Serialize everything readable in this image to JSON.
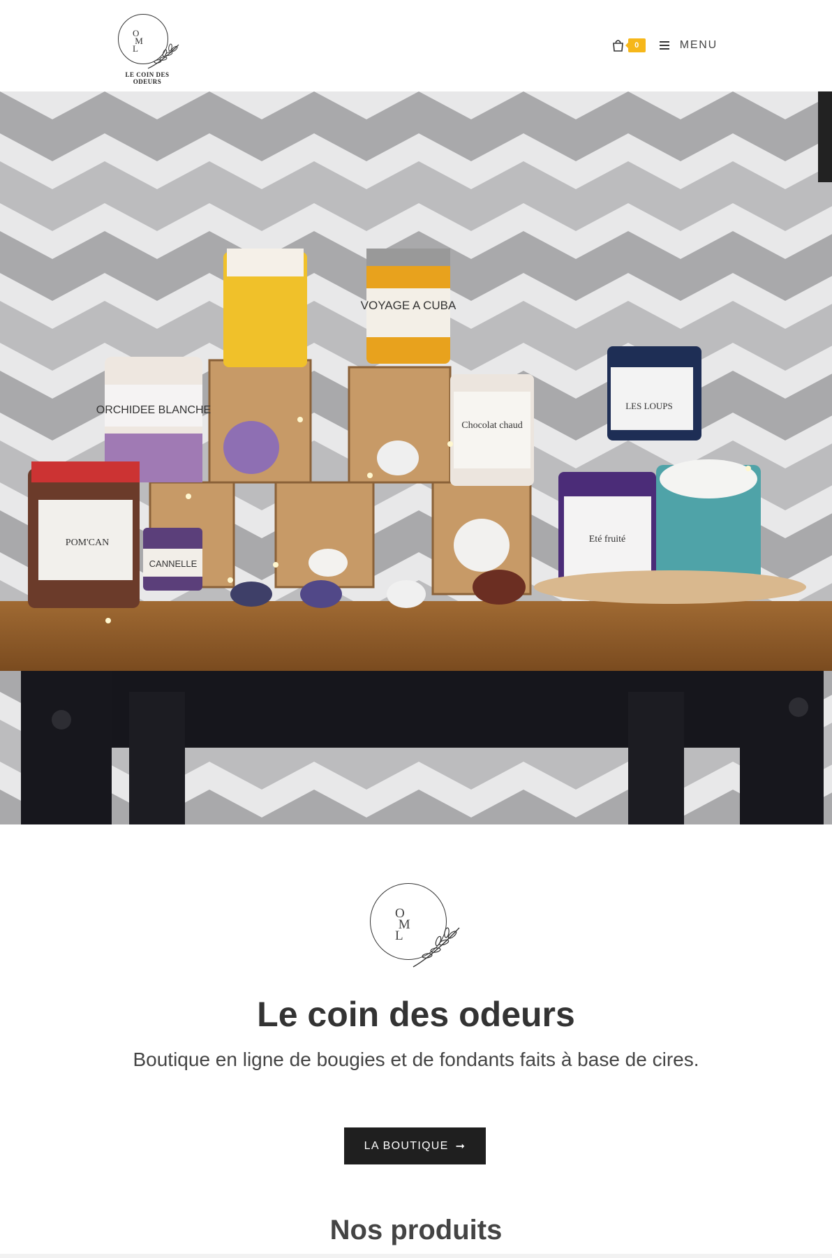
{
  "header": {
    "logo_text": "LE COIN DES ODEURS",
    "logo_monogram": "OML",
    "cart_count": "0",
    "menu_label": "MENU"
  },
  "hero": {
    "labels": {
      "orchidee": "ORCHIDEE BLANCHE",
      "voyage": "VOYAGE A CUBA",
      "chocolat": "Chocolat chaud",
      "loups": "LES LOUPS",
      "pomcan": "POM'CAN",
      "cannelle": "CANNELLE",
      "ete": "Eté fruité",
      "coin": "LE COIN DES ODEURS"
    }
  },
  "intro": {
    "monogram": "OML",
    "title": "Le coin des odeurs",
    "tagline": "Boutique en ligne de bougies et de fondants faits à base de cires.",
    "button_label": "LA BOUTIQUE",
    "button_arrow": "➞"
  },
  "products": {
    "title": "Nos produits"
  },
  "colors": {
    "accent": "#f6b71a",
    "button_bg": "#1f1f1f",
    "text": "#333333"
  }
}
